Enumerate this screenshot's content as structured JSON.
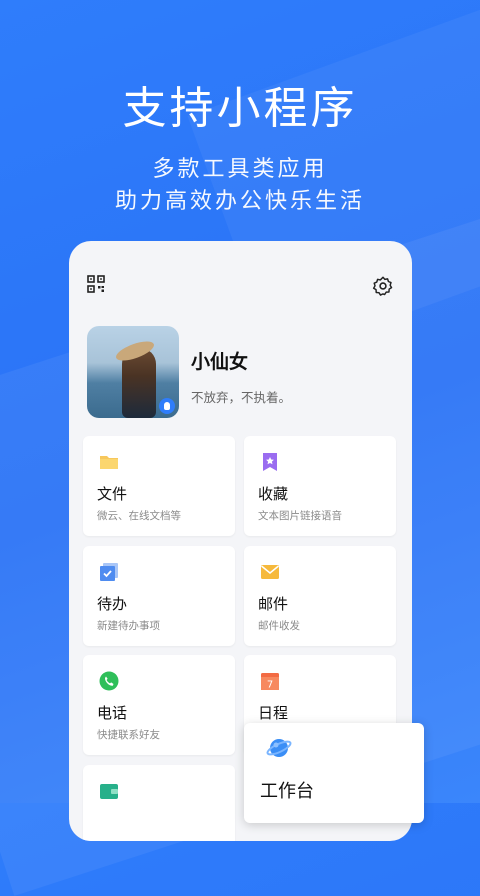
{
  "hero": {
    "title": "支持小程序",
    "subtitle_line1": "多款工具类应用",
    "subtitle_line2": "助力高效办公快乐生活"
  },
  "profile": {
    "name": "小仙女",
    "motto": "不放弃，不执着。"
  },
  "cards": [
    {
      "title": "文件",
      "subtitle": "微云、在线文档等",
      "icon": "folder-icon"
    },
    {
      "title": "收藏",
      "subtitle": "文本图片链接语音",
      "icon": "bookmark-star-icon"
    },
    {
      "title": "待办",
      "subtitle": "新建待办事项",
      "icon": "todo-check-icon"
    },
    {
      "title": "邮件",
      "subtitle": "邮件收发",
      "icon": "envelope-icon"
    },
    {
      "title": "电话",
      "subtitle": "快捷联系好友",
      "icon": "phone-icon"
    },
    {
      "title": "日程",
      "subtitle": "",
      "icon": "calendar-icon"
    },
    {
      "title": "",
      "subtitle": "",
      "icon": "wallet-icon"
    }
  ],
  "calendar_day": "7",
  "workbench": {
    "title": "工作台",
    "icon": "planet-icon"
  },
  "colors": {
    "brand_blue": "#2f7dfb",
    "folder": "#f7c75c",
    "bookmark": "#9a6cf0",
    "todo": "#4f8cf0",
    "mail": "#f6b93b",
    "phone": "#2fbf5a",
    "calendar": "#f36b43",
    "wallet": "#27b08a"
  }
}
